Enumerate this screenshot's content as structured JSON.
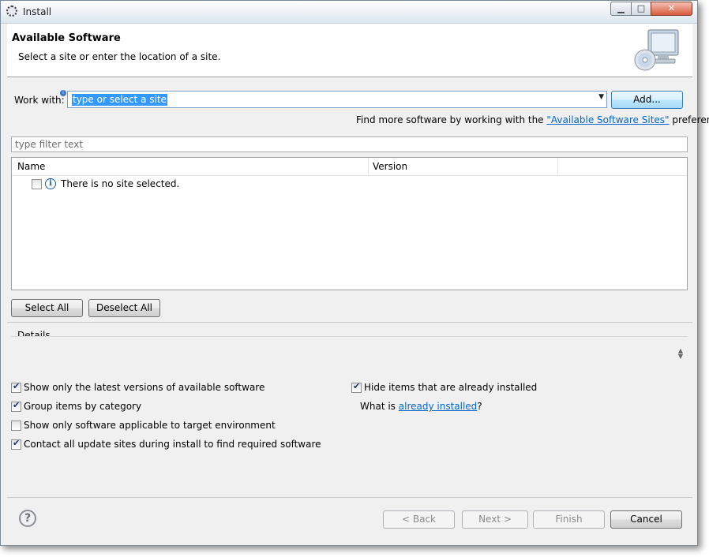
{
  "window": {
    "title": "Install",
    "controls": {
      "minimize": "▁",
      "maximize": "□",
      "close": "✕"
    }
  },
  "header": {
    "title": "Available Software",
    "subtitle": "Select a site or enter the location of a site."
  },
  "work_with": {
    "label": "Work with:",
    "value": "type or select a site",
    "add_button": "Add..."
  },
  "find_more": {
    "prefix": "Find more software by working with the ",
    "link": "\"Available Software Sites\"",
    "suffix": " preferences."
  },
  "filter": {
    "placeholder": "type filter text"
  },
  "table": {
    "columns": [
      "Name",
      "Version"
    ],
    "rows": [
      {
        "label": "There is no site selected.",
        "checked": false
      }
    ]
  },
  "selection_buttons": {
    "select_all": "Select All",
    "deselect_all": "Deselect All"
  },
  "details": {
    "label": "Details"
  },
  "options": {
    "latest_versions": {
      "label": "Show only the latest versions of available software",
      "checked": true
    },
    "group_by_category": {
      "label": "Group items by category",
      "checked": true
    },
    "target_env": {
      "label": "Show only software applicable to target environment",
      "checked": false
    },
    "contact_sites": {
      "label": "Contact all update sites during install to find required software",
      "checked": true
    },
    "hide_installed": {
      "label": "Hide items that are already installed",
      "checked": true
    },
    "what_is": {
      "prefix": "What is ",
      "link": "already installed",
      "suffix": "?"
    }
  },
  "footer": {
    "help": "?",
    "back": "< Back",
    "next": "Next >",
    "finish": "Finish",
    "cancel": "Cancel"
  },
  "colors": {
    "link": "#0066cc",
    "selection": "#3399ff"
  }
}
